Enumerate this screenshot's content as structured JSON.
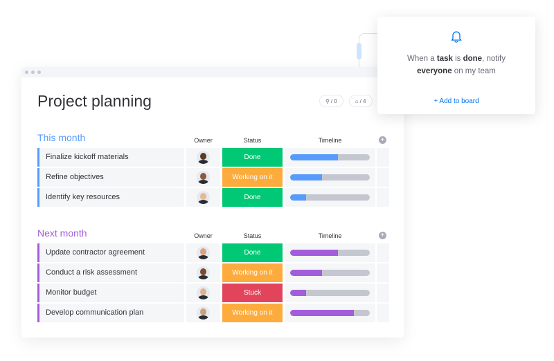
{
  "board": {
    "title": "Project planning",
    "automations_count": "/ 0",
    "integrations_count": "/ 4"
  },
  "columns": {
    "owner": "Owner",
    "status": "Status",
    "timeline": "Timeline"
  },
  "colors": {
    "done": "#00c875",
    "working": "#fdab3d",
    "stuck": "#e2445c",
    "this_month": "#579bfc",
    "next_month": "#a25ddc",
    "timeline_bg": "#c5c7d0"
  },
  "groups": [
    {
      "title": "This month",
      "color": "#579bfc",
      "rows": [
        {
          "name": "Finalize kickoff materials",
          "status": "Done",
          "timeline_progress": 0.6
        },
        {
          "name": "Refine objectives",
          "status": "Working on it",
          "timeline_progress": 0.4
        },
        {
          "name": "Identify key resources",
          "status": "Done",
          "timeline_progress": 0.2
        }
      ]
    },
    {
      "title": "Next month",
      "color": "#a25ddc",
      "rows": [
        {
          "name": "Update contractor agreement",
          "status": "Done",
          "timeline_progress": 0.6
        },
        {
          "name": "Conduct a risk assessment",
          "status": "Working on it",
          "timeline_progress": 0.4
        },
        {
          "name": "Monitor budget",
          "status": "Stuck",
          "timeline_progress": 0.2
        },
        {
          "name": "Develop communication plan",
          "status": "Working on it",
          "timeline_progress": 0.8
        }
      ]
    }
  ],
  "automation_card": {
    "icon": "bell-icon",
    "t1": "When a ",
    "t2": "task",
    "t3": " is ",
    "t4": "done",
    "t5": ", notify",
    "t6": "everyone",
    "t7": " on my team",
    "action": "+ Add to board"
  }
}
